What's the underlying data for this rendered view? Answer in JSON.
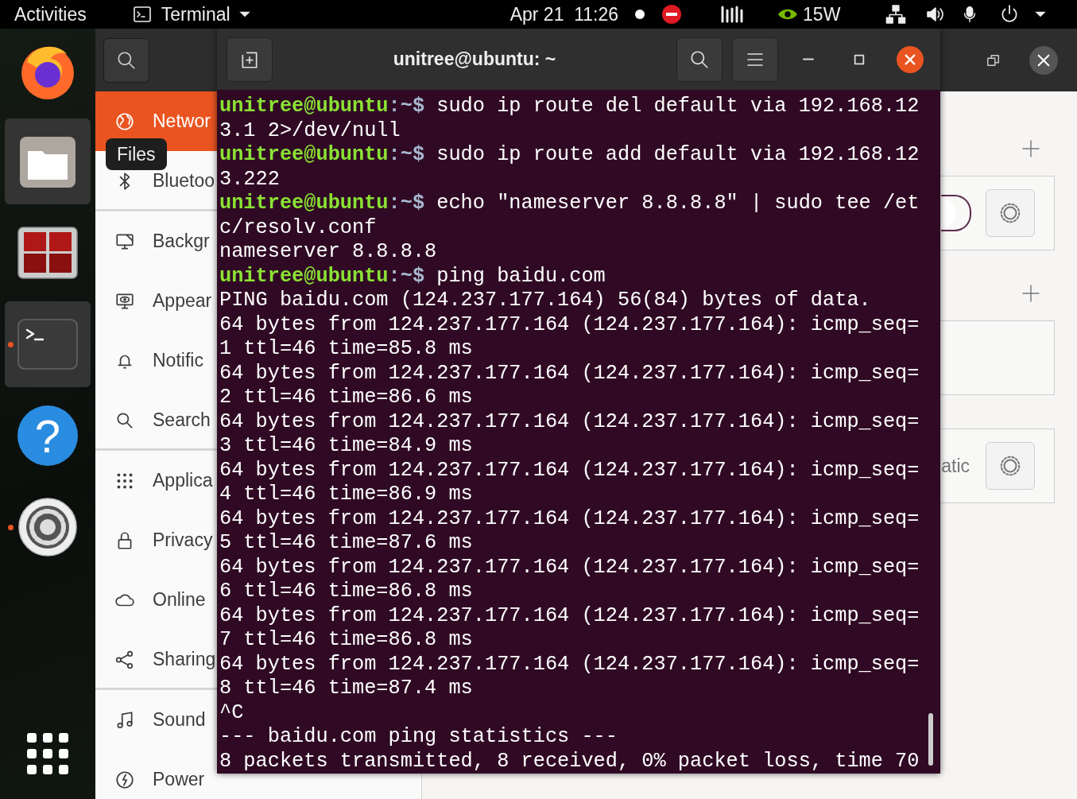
{
  "top_bar": {
    "activities": "Activities",
    "app_menu": "Terminal",
    "clock": "Apr 21  11:26",
    "power_draw": "15W"
  },
  "dock": [
    {
      "kind": "firefox",
      "highlighted": false,
      "running": false
    },
    {
      "kind": "files",
      "highlighted": true,
      "running": false
    },
    {
      "kind": "monitor",
      "highlighted": false,
      "running": false
    },
    {
      "kind": "terminal",
      "highlighted": true,
      "running": true
    },
    {
      "kind": "help",
      "highlighted": false,
      "running": false,
      "glyph": "?"
    },
    {
      "kind": "settings",
      "highlighted": false,
      "running": true
    }
  ],
  "tooltip": "Files",
  "settings": {
    "sidebar": [
      {
        "label": "Networ",
        "selected": true,
        "separator_after": false
      },
      {
        "label": "Bluetoo",
        "selected": false,
        "separator_after": true
      },
      {
        "label": "Backgr",
        "selected": false,
        "separator_after": false
      },
      {
        "label": "Appear",
        "selected": false,
        "separator_after": false
      },
      {
        "label": "Notific",
        "selected": false,
        "separator_after": false
      },
      {
        "label": "Search",
        "selected": false,
        "separator_after": true
      },
      {
        "label": "Applica",
        "selected": false,
        "separator_after": false
      },
      {
        "label": "Privacy",
        "selected": false,
        "separator_after": false
      },
      {
        "label": "Online",
        "selected": false,
        "separator_after": false
      },
      {
        "label": "Sharing",
        "selected": false,
        "separator_after": true
      },
      {
        "label": "Sound",
        "selected": false,
        "separator_after": false
      },
      {
        "label": "Power",
        "selected": false,
        "separator_after": false
      }
    ],
    "panel": [
      {
        "kind": "toggle-card",
        "on": false
      },
      {
        "kind": "empty-card"
      },
      {
        "kind": "text-card",
        "text": "atic"
      }
    ]
  },
  "terminal": {
    "title": "unitree@ubuntu: ~",
    "lines": [
      {
        "user": "unitree@ubuntu",
        "path": ":~$",
        "text": " sudo ip route del default via 192.168.12"
      },
      {
        "text": "3.1 2>/dev/null"
      },
      {
        "user": "unitree@ubuntu",
        "path": ":~$",
        "text": " sudo ip route add default via 192.168.12"
      },
      {
        "text": "3.222"
      },
      {
        "user": "unitree@ubuntu",
        "path": ":~$",
        "text": " echo \"nameserver 8.8.8.8\" | sudo tee /et"
      },
      {
        "text": "c/resolv.conf"
      },
      {
        "text": "nameserver 8.8.8.8"
      },
      {
        "user": "unitree@ubuntu",
        "path": ":~$",
        "text": " ping baidu.com"
      },
      {
        "text": "PING baidu.com (124.237.177.164) 56(84) bytes of data."
      },
      {
        "text": "64 bytes from 124.237.177.164 (124.237.177.164): icmp_seq="
      },
      {
        "text": "1 ttl=46 time=85.8 ms"
      },
      {
        "text": "64 bytes from 124.237.177.164 (124.237.177.164): icmp_seq="
      },
      {
        "text": "2 ttl=46 time=86.6 ms"
      },
      {
        "text": "64 bytes from 124.237.177.164 (124.237.177.164): icmp_seq="
      },
      {
        "text": "3 ttl=46 time=84.9 ms"
      },
      {
        "text": "64 bytes from 124.237.177.164 (124.237.177.164): icmp_seq="
      },
      {
        "text": "4 ttl=46 time=86.9 ms"
      },
      {
        "text": "64 bytes from 124.237.177.164 (124.237.177.164): icmp_seq="
      },
      {
        "text": "5 ttl=46 time=87.6 ms"
      },
      {
        "text": "64 bytes from 124.237.177.164 (124.237.177.164): icmp_seq="
      },
      {
        "text": "6 ttl=46 time=86.8 ms"
      },
      {
        "text": "64 bytes from 124.237.177.164 (124.237.177.164): icmp_seq="
      },
      {
        "text": "7 ttl=46 time=86.8 ms"
      },
      {
        "text": "64 bytes from 124.237.177.164 (124.237.177.164): icmp_seq="
      },
      {
        "text": "8 ttl=46 time=87.4 ms"
      },
      {
        "text": "^C"
      },
      {
        "text": "--- baidu.com ping statistics ---"
      },
      {
        "text": "8 packets transmitted, 8 received, 0% packet loss, time 70"
      }
    ]
  }
}
